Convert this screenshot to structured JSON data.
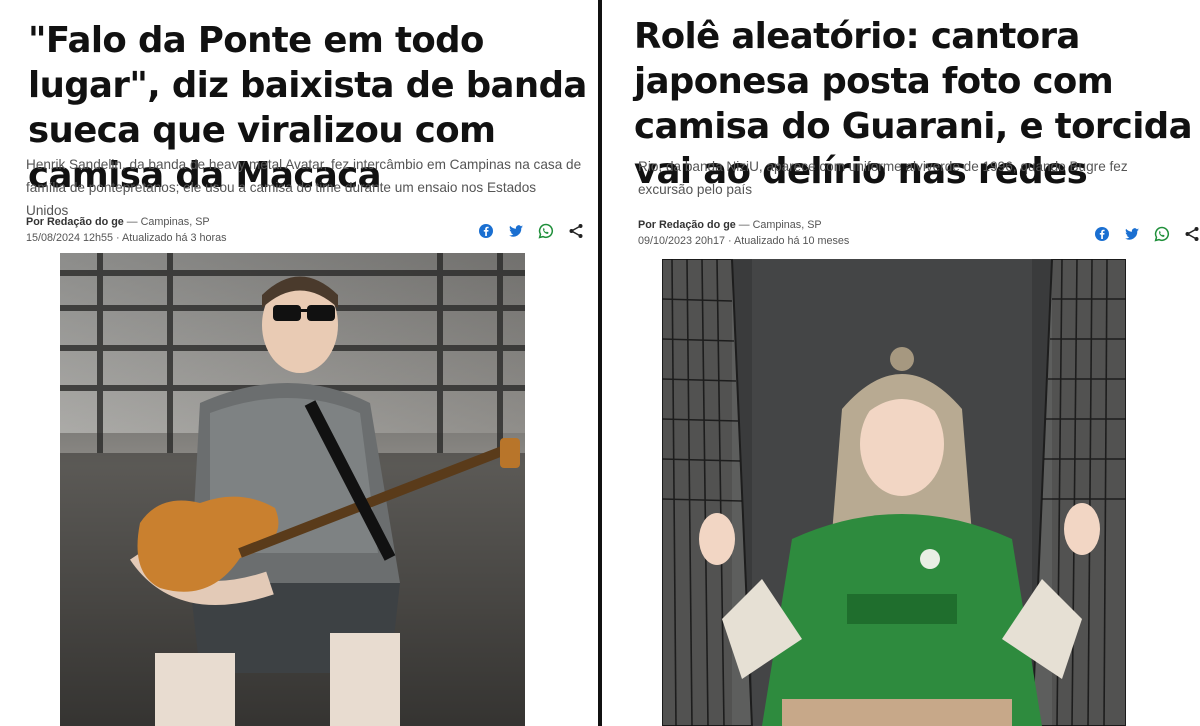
{
  "left_article": {
    "headline": "\"Falo da Ponte em todo lugar\", diz baixista de banda sueca que viralizou com camisa da Macaca",
    "subtitle": "Henrik Sandelin, da banda de heavy metal Avatar, fez intercâmbio em Campinas na casa de família de pontepretanos; ele usou a camisa do time durante um ensaio nos Estados Unidos",
    "author": "Por Redação do ge",
    "location": " — Campinas, SP",
    "datetime": "15/08/2024 12h55 · Atualizado há 3 horas",
    "share_icons": [
      "facebook-icon",
      "twitter-icon",
      "whatsapp-icon",
      "share-icon"
    ]
  },
  "right_article": {
    "headline": "Rolê aleatório: cantora japonesa posta foto com camisa do Guarani, e torcida vai ao delírio nas redes",
    "subtitle": "Rio, da banda NiziU, aparece com uniforme alviverde de 1996, quando Bugre fez excursão pelo país",
    "author": "Por Redação do ge",
    "location": " — Campinas, SP",
    "datetime": "09/10/2023 20h17 · Atualizado há 10 meses",
    "share_icons": [
      "facebook-icon",
      "twitter-icon",
      "whatsapp-icon",
      "share-icon"
    ]
  },
  "colors": {
    "share_blue": "#1a6fd1",
    "share_green": "#1f8f3a",
    "text_dark": "#111111",
    "text_muted": "#555555",
    "divider": "#111111"
  }
}
